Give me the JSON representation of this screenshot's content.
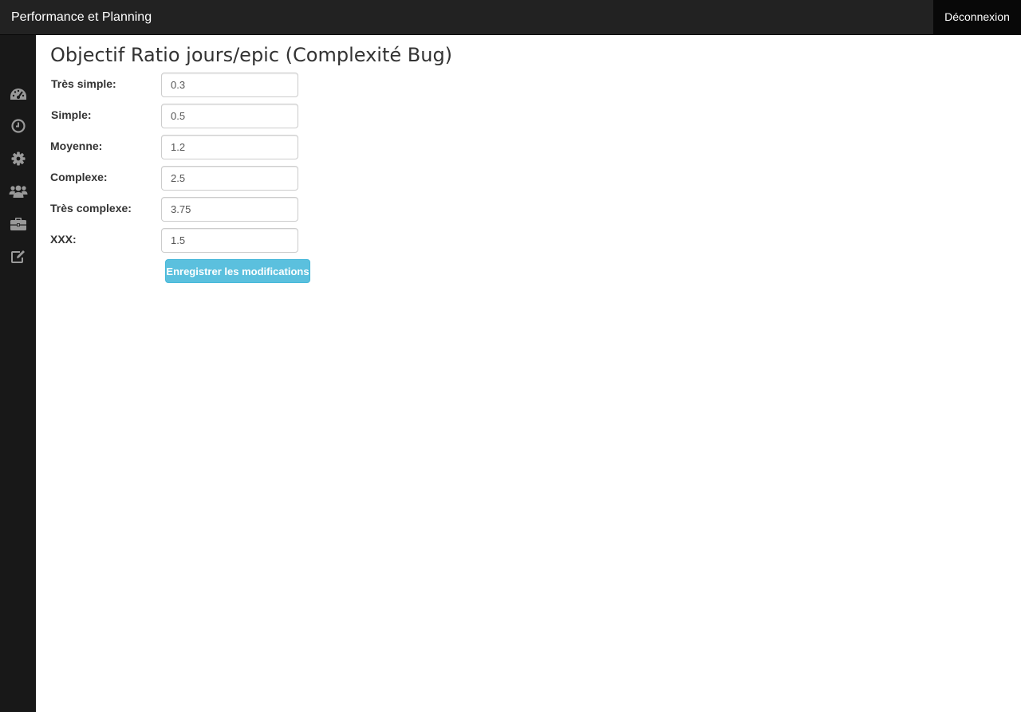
{
  "navbar": {
    "brand": "Performance et Planning",
    "logout_label": "Déconnexion"
  },
  "sidebar": {
    "items": [
      {
        "icon": "dashboard-icon"
      },
      {
        "icon": "clock-icon"
      },
      {
        "icon": "gear-icon"
      },
      {
        "icon": "users-icon"
      },
      {
        "icon": "briefcase-icon"
      },
      {
        "icon": "edit-icon"
      }
    ],
    "icon_color": "#999999"
  },
  "page": {
    "title": "Objectif Ratio jours/epic (Complexité Bug)"
  },
  "form": {
    "fields": [
      {
        "label": "Très simple:",
        "value": "0.3"
      },
      {
        "label": "Simple:",
        "value": "0.5"
      },
      {
        "label": "Moyenne:",
        "value": "1.2"
      },
      {
        "label": "Complexe:",
        "value": "2.5"
      },
      {
        "label": "Très complexe:",
        "value": "3.75"
      },
      {
        "label": "XXX:",
        "value": "1.5"
      }
    ],
    "save_label": "Enregistrer les modifications"
  },
  "colors": {
    "navbar_bg": "#222222",
    "sidebar_bg": "#181818",
    "button_bg": "#5bc0de"
  }
}
